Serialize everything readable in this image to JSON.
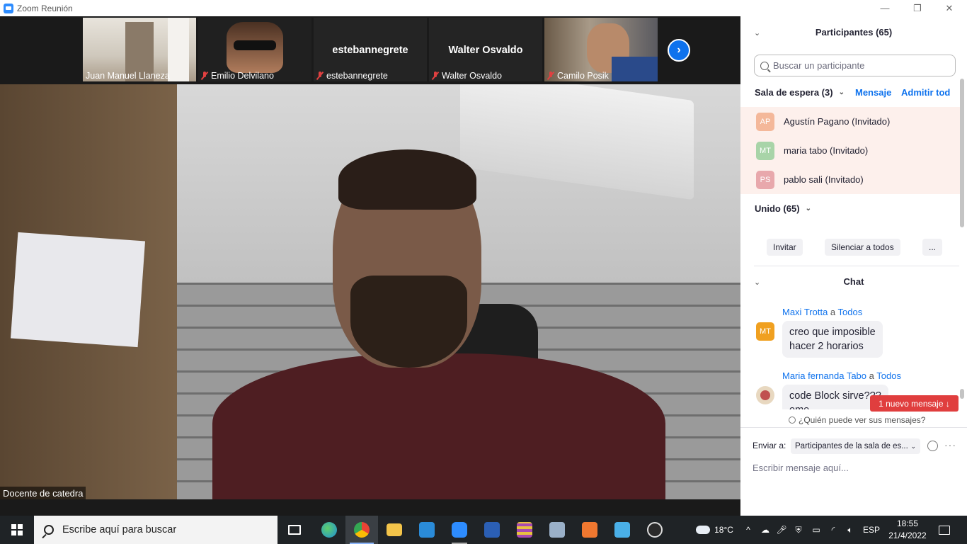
{
  "window": {
    "title": "Zoom Reunión",
    "controls": {
      "minimize": "—",
      "restore": "❐",
      "close": "✕"
    }
  },
  "video_strip": {
    "tiles": [
      {
        "name": "Juan Manuel Llaneza",
        "muted": false,
        "has_video": true
      },
      {
        "name": "Emilio Delvilano",
        "muted": true,
        "has_video": true
      },
      {
        "name": "estebannegrete",
        "muted": true,
        "has_video": false,
        "display_name": "estebannegrete"
      },
      {
        "name": "Walter Osvaldo",
        "muted": true,
        "has_video": false,
        "display_name": "Walter Osvaldo"
      },
      {
        "name": "Camilo Posik",
        "muted": true,
        "has_video": true
      }
    ],
    "next_icon": "›"
  },
  "main_video": {
    "speaker_label": "Docente de catedra"
  },
  "participants_panel": {
    "title": "Participantes (65)",
    "search_placeholder": "Buscar un participante",
    "waiting_room": {
      "label": "Sala de espera (3)",
      "message_link": "Mensaje",
      "admit_all_link": "Admitir tod",
      "people": [
        {
          "initials": "AP",
          "name": "Agustín Pagano  (Invitado)",
          "color": "#f4b89a"
        },
        {
          "initials": "MT",
          "name": "maria tabo (Invitado)",
          "color": "#a8d4a8"
        },
        {
          "initials": "PS",
          "name": "pablo sali (Invitado)",
          "color": "#e8a8ac"
        }
      ]
    },
    "joined_label": "Unido (65)",
    "actions": {
      "invite": "Invitar",
      "mute_all": "Silenciar a todos",
      "more": "..."
    }
  },
  "chat": {
    "title": "Chat",
    "messages": [
      {
        "sender": "Maxi Trotta",
        "to_word": "a",
        "recipient": "Todos",
        "initials": "MT",
        "avatar_color": "#f0a020",
        "lines": [
          "creo que imposible",
          "hacer 2 horarios"
        ]
      },
      {
        "sender": "Maria fernanda Tabo",
        "to_word": "a",
        "recipient": "Todos",
        "initials": "",
        "avatar_color": "#e8d8c0",
        "lines": [
          "code Block sirve???",
          "ome"
        ]
      }
    ],
    "new_message_badge": "1 nuevo mensaje ↓",
    "who_sees": "¿Quién puede ver sus mensajes?",
    "send_to_label": "Enviar a:",
    "send_to_value": "Participantes de la sala de es...",
    "input_placeholder": "Escribir mensaje aquí...",
    "more_label": "···"
  },
  "taskbar": {
    "search_placeholder": "Escribe aquí para buscar",
    "apps": [
      {
        "name": "task-view",
        "color": "#ffffff"
      },
      {
        "name": "edge",
        "color": "#2fa4e7"
      },
      {
        "name": "chrome",
        "color": "#e8b838"
      },
      {
        "name": "file-explorer",
        "color": "#f3c44a"
      },
      {
        "name": "vscode",
        "color": "#2a8bd8"
      },
      {
        "name": "zoom",
        "color": "#2d8cff"
      },
      {
        "name": "word",
        "color": "#2b5fb4"
      },
      {
        "name": "winrar",
        "color": "#a84ab0"
      },
      {
        "name": "image-viewer",
        "color": "#6a8ab0"
      },
      {
        "name": "xampp",
        "color": "#f07830"
      },
      {
        "name": "control-panel",
        "color": "#4ab0e8"
      },
      {
        "name": "obs",
        "color": "#3a3a3a"
      }
    ],
    "weather": "18°C",
    "language": "ESP",
    "time": "18:55",
    "date": "21/4/2022"
  }
}
